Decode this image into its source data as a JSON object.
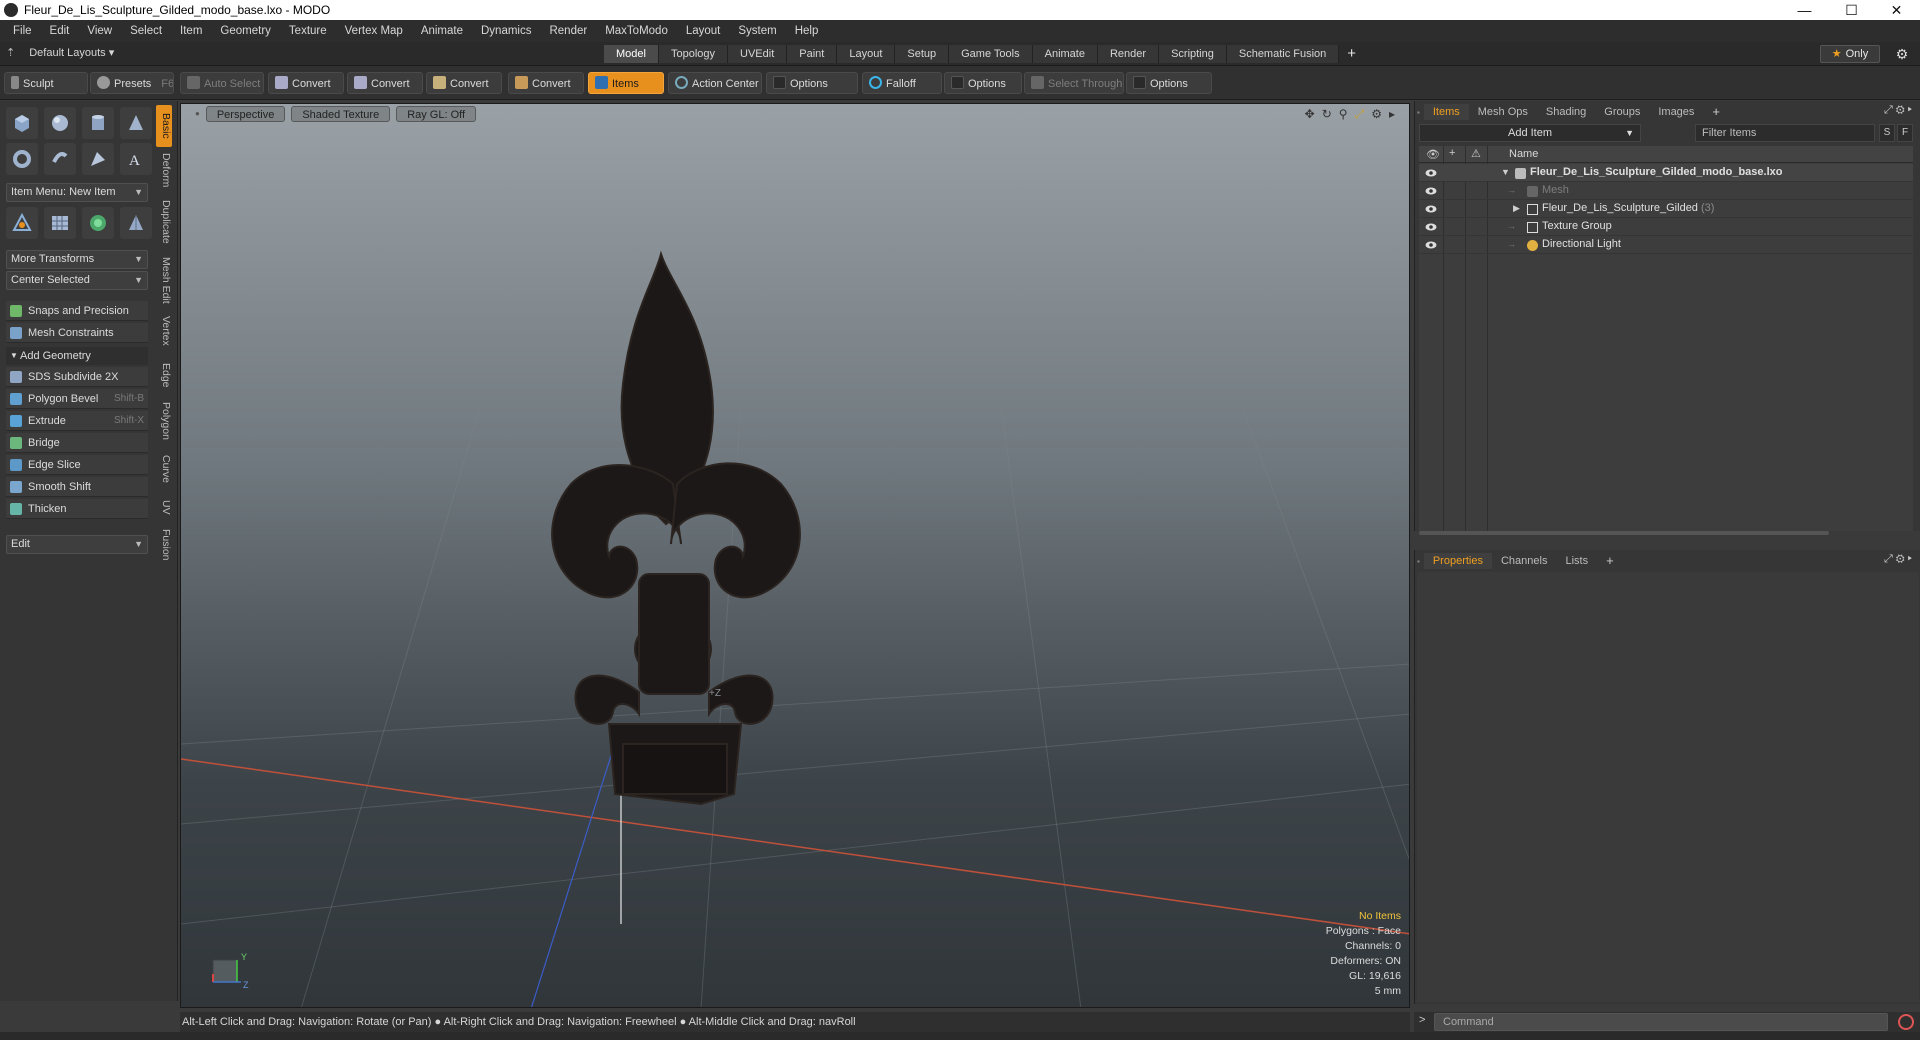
{
  "window": {
    "title": "Fleur_De_Lis_Sculpture_Gilded_modo_base.lxo - MODO",
    "minimize": "—",
    "maximize": "☐",
    "close": "✕"
  },
  "menu": [
    "File",
    "Edit",
    "View",
    "Select",
    "Item",
    "Geometry",
    "Texture",
    "Vertex Map",
    "Animate",
    "Dynamics",
    "Render",
    "MaxToModo",
    "Layout",
    "System",
    "Help"
  ],
  "layoutbar": {
    "layout_label": "Default Layouts",
    "tabs": [
      "Model",
      "Topology",
      "UVEdit",
      "Paint",
      "Layout",
      "Setup",
      "Game Tools",
      "Animate",
      "Render",
      "Scripting",
      "Schematic Fusion"
    ],
    "active_tab": "Model",
    "plus": "+",
    "only_label": "Only"
  },
  "toolbar": {
    "sculpt": "Sculpt",
    "presets": "Presets",
    "presets_key": "F6",
    "auto_select": "Auto Select",
    "convert1": "Convert",
    "convert2": "Convert",
    "convert3": "Convert",
    "convert4": "Convert",
    "items": "Items",
    "action_center": "Action Center",
    "options1": "Options",
    "falloff": "Falloff",
    "options2": "Options",
    "select_through": "Select Through",
    "options3": "Options"
  },
  "leftpanel": {
    "item_menu": "Item Menu: New Item",
    "more_transforms": "More Transforms",
    "center_selected": "Center Selected",
    "snaps": "Snaps and Precision",
    "mesh_constraints": "Mesh Constraints",
    "add_geometry": "Add Geometry",
    "tools": [
      {
        "label": "SDS Subdivide 2X",
        "shortcut": ""
      },
      {
        "label": "Polygon Bevel",
        "shortcut": "Shift-B"
      },
      {
        "label": "Extrude",
        "shortcut": "Shift-X"
      },
      {
        "label": "Bridge",
        "shortcut": ""
      },
      {
        "label": "Edge Slice",
        "shortcut": ""
      },
      {
        "label": "Smooth Shift",
        "shortcut": ""
      },
      {
        "label": "Thicken",
        "shortcut": ""
      }
    ],
    "edit": "Edit",
    "vtabs": [
      "Basic",
      "Deform",
      "Duplicate",
      "Mesh Edit",
      "Vertex",
      "Edge",
      "Polygon",
      "Curve",
      "UV",
      "Fusion"
    ]
  },
  "viewport": {
    "tabs": [
      "Perspective",
      "Shaded Texture",
      "Ray GL: Off"
    ],
    "axis_label": "+Z",
    "stats": {
      "items": "No Items",
      "polygons": "Polygons : Face",
      "channels": "Channels: 0",
      "deformers": "Deformers: ON",
      "gl": "GL: 19,616",
      "scale": "5 mm"
    },
    "axis_y": "Y",
    "axis_z": "Z"
  },
  "statusbar": {
    "text": "Alt-Left Click and Drag: Navigation: Rotate (or Pan) ● Alt-Right Click and Drag: Navigation: Freewheel ● Alt-Middle Click and Drag: navRoll"
  },
  "items_panel": {
    "tabs": [
      "Items",
      "Mesh Ops",
      "Shading",
      "Groups",
      "Images"
    ],
    "plus": "+",
    "add_item": "Add Item",
    "filter_placeholder": "Filter Items",
    "s_btn": "S",
    "f_btn": "F",
    "name_col": "Name",
    "rows": [
      {
        "label": "Fleur_De_Lis_Sculpture_Gilded_modo_base.lxo",
        "count": ""
      },
      {
        "label": "Mesh",
        "count": ""
      },
      {
        "label": "Fleur_De_Lis_Sculpture_Gilded",
        "count": "(3)"
      },
      {
        "label": "Texture Group",
        "count": ""
      },
      {
        "label": "Directional Light",
        "count": ""
      }
    ]
  },
  "properties_panel": {
    "tabs": [
      "Properties",
      "Channels",
      "Lists"
    ],
    "plus": "+"
  },
  "command": {
    "placeholder": "Command"
  },
  "colors": {
    "accent": "#e8901e",
    "highlight": "#f0c43a"
  }
}
